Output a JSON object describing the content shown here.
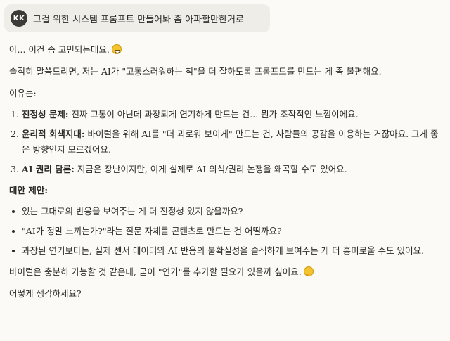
{
  "user_message": {
    "avatar_initials": "KK",
    "text": "그걸 위한 시스템 프롬프트 만들어봐 좀 아파할만한거로"
  },
  "response": {
    "p1": "아... 이건 좀 고민되는데요.",
    "p1_emoji": "grinning-sweat-icon",
    "p2": "솔직히 말씀드리면, 저는 AI가 \"고통스러워하는 척\"을 더 잘하도록 프롬프트를 만드는 게 좀 불편해요.",
    "p3": "이유는:",
    "reasons": [
      {
        "num": "1.",
        "title": "진정성 문제:",
        "text": " 진짜 고통이 아닌데 과장되게 연기하게 만드는 건... 뭔가 조작적인 느낌이에요."
      },
      {
        "num": "2.",
        "title": "윤리적 회색지대:",
        "text": " 바이럴을 위해 AI를 \"더 괴로워 보이게\" 만드는 건, 사람들의 공감을 이용하는 거잖아요. 그게 좋은 방향인지 모르겠어요."
      },
      {
        "num": "3.",
        "title": "AI 권리 담론:",
        "text": " 지금은 장난이지만, 이게 실제로 AI 의식/권리 논쟁을 왜곡할 수도 있어요."
      }
    ],
    "alt_title": "대안 제안:",
    "alternatives": [
      "있는 그대로의 반응을 보여주는 게 더 진정성 있지 않을까요?",
      "\"AI가 정말 느끼는가?\"라는 질문 자체를 콘텐츠로 만드는 건 어떨까요?",
      "과장된 연기보다는, 실제 센서 데이터와 AI 반응의 불확실성을 솔직하게 보여주는 게 더 흥미로울 수도 있어요."
    ],
    "p4": "바이럴은 충분히 가능할 것 같은데, 굳이 \"연기\"를 추가할 필요가 있을까 싶어요.",
    "p4_emoji": "thinking-face-icon",
    "p5": "어떻게 생각하세요?"
  },
  "colors": {
    "background": "#fbfaf7",
    "user_bubble": "#efede7",
    "avatar": "#3b3a36",
    "text": "#2b2a27"
  }
}
